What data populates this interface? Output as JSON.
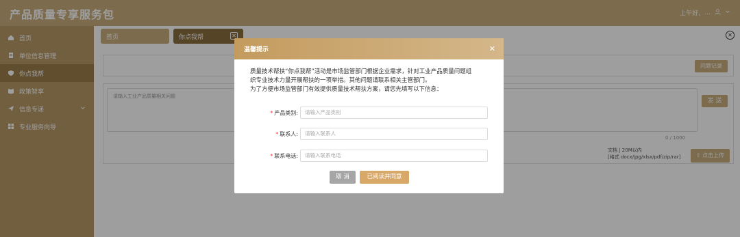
{
  "app": {
    "title": "产品质量专享服务包"
  },
  "topbar": {
    "greeting": "上午好,",
    "user": "…",
    "user_icon": "user-icon",
    "dropdown_icon": "chevron-down-icon"
  },
  "sidebar": {
    "items": [
      {
        "label": "首页",
        "icon": "home-icon",
        "active": false
      },
      {
        "label": "单位信息管理",
        "icon": "document-icon",
        "active": false
      },
      {
        "label": "你点我帮",
        "icon": "shield-icon",
        "active": true
      },
      {
        "label": "政策智享",
        "icon": "book-icon",
        "active": false
      },
      {
        "label": "信息专递",
        "icon": "send-icon",
        "active": false,
        "has_children": true
      },
      {
        "label": "专业服务向导",
        "icon": "grid-icon",
        "active": false
      }
    ]
  },
  "tabs": [
    {
      "label": "首页"
    },
    {
      "label": "你点我帮",
      "closable": true
    }
  ],
  "main": {
    "record_button": "问题记录",
    "textarea_placeholder": "请输入工业产品质量相关问题",
    "counter": "0 / 1000",
    "send_button": "发 送",
    "upload_note_line1": "文档 | 20M以内",
    "upload_note_line2": "[格式 docx/jpg/xlsx/pdf/zip/rar]",
    "upload_button": "点击上传"
  },
  "modal": {
    "title": "温馨提示",
    "body_line1": "质量技术帮扶“你点我帮”活动是市场监管部门根据企业需求，针对工业产品质量问题组",
    "body_line2": "织专业技术力量开展帮扶的一项举措。其他问题请联系相关主管部门。",
    "body_line3": "为了方便市场监管部门有效提供质量技术帮扶方案，请您先填写以下信息：",
    "fields": [
      {
        "label": "产品类别:",
        "placeholder": "请输入产品类别",
        "required": true
      },
      {
        "label": "联系人:",
        "placeholder": "请输入联系人",
        "required": true
      },
      {
        "label": "联系电话:",
        "placeholder": "请输入联系电话",
        "required": true
      }
    ],
    "cancel_button": "取 消",
    "agree_button": "已阅读并同意"
  },
  "colors": {
    "brand": "#c9ad7c",
    "sidebar": "#b79a68",
    "sidebar_active": "#9c7f4c",
    "agree": "#d8a868",
    "required": "#ee3333"
  }
}
